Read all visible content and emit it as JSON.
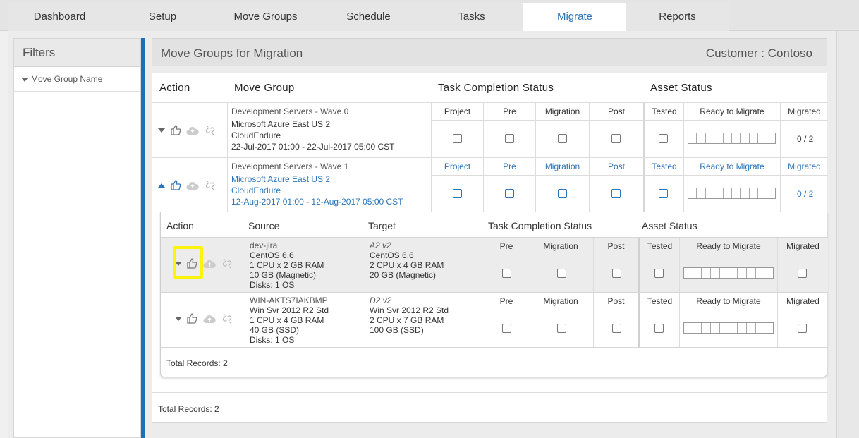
{
  "tabs": [
    "Dashboard",
    "Setup",
    "Move Groups",
    "Schedule",
    "Tasks",
    "Migrate",
    "Reports"
  ],
  "active_tab": "Migrate",
  "filters": {
    "title": "Filters",
    "item": "Move Group Name"
  },
  "main": {
    "title": "Move Groups for Migration",
    "customer": "Customer : Contoso"
  },
  "table": {
    "headers": {
      "action": "Action",
      "move_group": "Move Group",
      "task_status": "Task Completion Status",
      "asset_status": "Asset Status"
    },
    "sub_headers": [
      "Project",
      "Pre",
      "Migration",
      "Post",
      "Tested",
      "Ready to Migrate",
      "Migrated"
    ],
    "rows": [
      {
        "name": "Development Servers - Wave 0",
        "region": "Microsoft Azure East US 2",
        "tool": "CloudEndure",
        "window": "22-Jul-2017 01:00 - 22-Jul-2017 05:00 CST",
        "migrated": "0 / 2",
        "expanded": false
      },
      {
        "name": "Development Servers - Wave 1",
        "region": "Microsoft Azure East US 2",
        "tool": "CloudEndure",
        "window": "12-Aug-2017 01:00 - 12-Aug-2017 05:00 CST",
        "migrated": "0 / 2",
        "expanded": true
      }
    ],
    "total": "Total Records: 2"
  },
  "inner": {
    "headers": {
      "action": "Action",
      "source": "Source",
      "target": "Target",
      "task_status": "Task Completion Status",
      "asset_status": "Asset Status"
    },
    "sub_headers": [
      "Pre",
      "Migration",
      "Post",
      "Tested",
      "Ready to Migrate",
      "Migrated"
    ],
    "rows": [
      {
        "src_name": "dev-jira",
        "src_os": "CentOS 6.6",
        "src_cpu": "1 CPU x 2 GB RAM",
        "src_disk": "10 GB (Magnetic)",
        "src_disks": "Disks: 1 OS",
        "tgt_size": "A2 v2",
        "tgt_os": "CentOS 6.6",
        "tgt_cpu": "2 CPU x 4 GB RAM",
        "tgt_disk": "20 GB (Magnetic)"
      },
      {
        "src_name": "WIN-AKTS7IAKBMP",
        "src_os": "Win Svr 2012 R2 Std",
        "src_cpu": "1 CPU x 4 GB RAM",
        "src_disk": "40 GB (SSD)",
        "src_disks": "Disks: 1 OS",
        "tgt_size": "D2 v2",
        "tgt_os": "Win Svr 2012 R2 Std",
        "tgt_cpu": "2 CPU x 7 GB RAM",
        "tgt_disk": "100 GB (SSD)"
      }
    ],
    "total": "Total Records: 2"
  },
  "icons": [
    "expand-caret-icon",
    "thumbs-up-icon",
    "cloud-upload-icon",
    "unlink-icon"
  ],
  "colors": {
    "accent": "#2c75b8",
    "highlight": "#fbf40a"
  }
}
